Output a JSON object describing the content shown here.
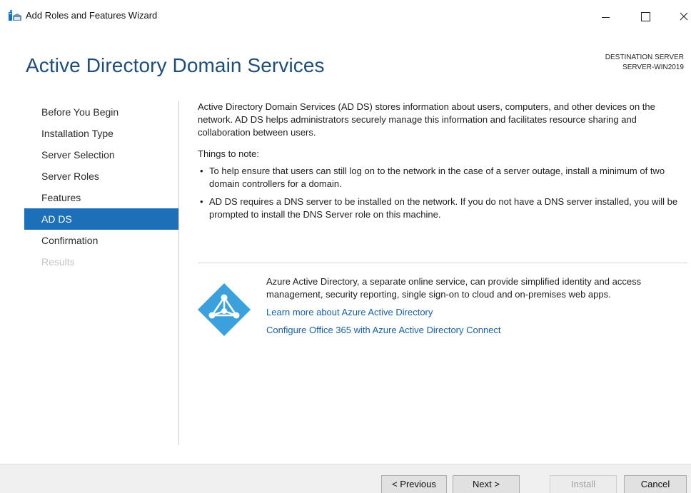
{
  "window": {
    "title": "Add Roles and Features Wizard",
    "minimize_icon": "minimize-icon",
    "maximize_icon": "maximize-icon",
    "close_icon": "close-icon"
  },
  "header": {
    "title": "Active Directory Domain Services",
    "destination_label": "DESTINATION SERVER",
    "destination_server": "SERVER-WIN2019"
  },
  "nav": {
    "items": [
      {
        "label": "Before You Begin",
        "state": "normal"
      },
      {
        "label": "Installation Type",
        "state": "normal"
      },
      {
        "label": "Server Selection",
        "state": "normal"
      },
      {
        "label": "Server Roles",
        "state": "normal"
      },
      {
        "label": "Features",
        "state": "normal"
      },
      {
        "label": "AD DS",
        "state": "active"
      },
      {
        "label": "Confirmation",
        "state": "normal"
      },
      {
        "label": "Results",
        "state": "disabled"
      }
    ]
  },
  "content": {
    "intro": "Active Directory Domain Services (AD DS) stores information about users, computers, and other devices on the network.  AD DS helps administrators securely manage this information and facilitates resource sharing and collaboration between users.",
    "notes_heading": "Things to note:",
    "bullets": [
      "To help ensure that users can still log on to the network in the case of a server outage, install a minimum of two domain controllers for a domain.",
      "AD DS requires a DNS server to be installed on the network.  If you do not have a DNS server installed, you will be prompted to install the DNS Server role on this machine."
    ],
    "bullet_symbol": "•"
  },
  "azure": {
    "logo_icon": "azure-ad-logo-icon",
    "description": "Azure Active Directory, a separate online service, can provide simplified identity and access management, security reporting, single sign-on to cloud and on-premises web apps.",
    "links": [
      "Learn more about Azure Active Directory",
      "Configure Office 365 with Azure Active Directory Connect"
    ]
  },
  "footer": {
    "previous": "< Previous",
    "next": "Next >",
    "install": "Install",
    "cancel": "Cancel"
  },
  "colors": {
    "accent": "#1d70b7",
    "heading": "#1e4e79",
    "link": "#1a5fa8",
    "azure": "#3ca0dc"
  }
}
